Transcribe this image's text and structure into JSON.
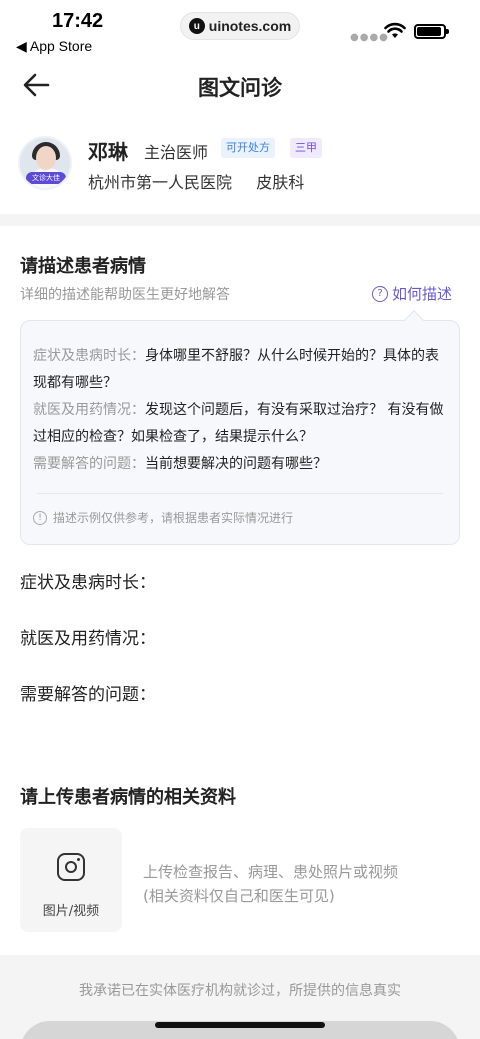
{
  "status_bar": {
    "time": "17:42",
    "back_app": "◀ App Store",
    "watermark": "uinotes.com"
  },
  "nav": {
    "title": "图文问诊"
  },
  "doctor": {
    "name": "邓琳",
    "title": "主治医师",
    "badge_rx": "可开处方",
    "badge_level": "三甲",
    "hospital": "杭州市第一人民医院",
    "department": "皮肤科",
    "avatar_tag": "文诊大佳"
  },
  "description": {
    "title": "请描述患者病情",
    "subtitle": "详细的描述能帮助医生更好地解答",
    "how_link": "如何描述",
    "example": {
      "label1": "症状及患病时长：",
      "text1": "身体哪里不舒服？从什么时候开始的？具体的表现都有哪些？",
      "label2": "就医及用药情况：",
      "text2": "发现这个问题后，有没有采取过治疗？ 有没有做过相应的检查？如果检查了，结果提示什么？",
      "label3": "需要解答的问题：",
      "text3": "当前想要解决的问题有哪些？",
      "note": "描述示例仅供参考，请根据患者实际情况进行"
    },
    "fields": {
      "symptoms": "症状及患病时长：",
      "treatment": "就医及用药情况：",
      "questions": "需要解答的问题："
    }
  },
  "upload": {
    "title": "请上传患者病情的相关资料",
    "button_label": "图片/视频",
    "hint_line1": "上传检查报告、病理、患处照片或视频",
    "hint_line2": "(相关资料仅自己和医生可见)"
  },
  "footer": {
    "promise": "我承诺已在实体医疗机构就诊过，所提供的信息真实"
  }
}
